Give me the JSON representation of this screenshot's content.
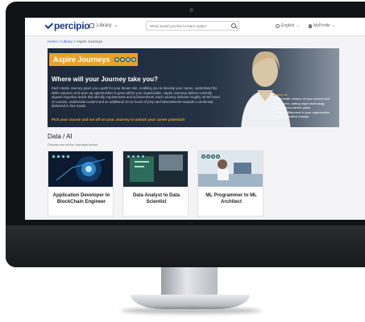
{
  "app": {
    "logo_text": "percipio",
    "library_label": "Library",
    "search_placeholder": "What would you like to learn today?",
    "language_label": "English",
    "user_label": "MyProfile"
  },
  "breadcrumb": {
    "home": "Home",
    "separator": ">",
    "library": "Library",
    "current": "Aspire Journeys"
  },
  "hero": {
    "title": "Aspire Journeys",
    "heading": "Where will your Journey take you?",
    "body": "Each Aspire Journey gives you a path for your dream role, enabling you to develop your career, understand the skills required, and open up opportunities to grow within your organization. Aspire Journeys deliver carefully aligned expertise levels that identify requirements and achievements. Each Journey delivers roughly 40-60 hours of courses, multimodal content and an additional 10-12 hours of prep and assessments towards a credential, delivered in four tracks.",
    "cta": "Pick your course and set off on your Journey to unlock your career potential!",
    "aspire_title": "Aspire to:",
    "aspire_items": [
      "• be a better version of your current self",
      "• learn new, cutting edge technology",
      "• unlock your career goals",
      "• make a difference in your organization",
      "• make a positive change"
    ]
  },
  "section": {
    "title": "Data / AI",
    "subtitle": "Choose one of the Journeys below."
  },
  "cards": [
    {
      "title": "Application Developer to BlockChain Engineer"
    },
    {
      "title": "Data Analyst to Data Scientist"
    },
    {
      "title": "ML Programmer to ML Architect"
    }
  ],
  "colors": {
    "brand_blue": "#1a3a8f",
    "accent_orange": "#e9a228",
    "hero_dark": "#1e2a3a",
    "journey_dot": "#8ad0c8"
  }
}
